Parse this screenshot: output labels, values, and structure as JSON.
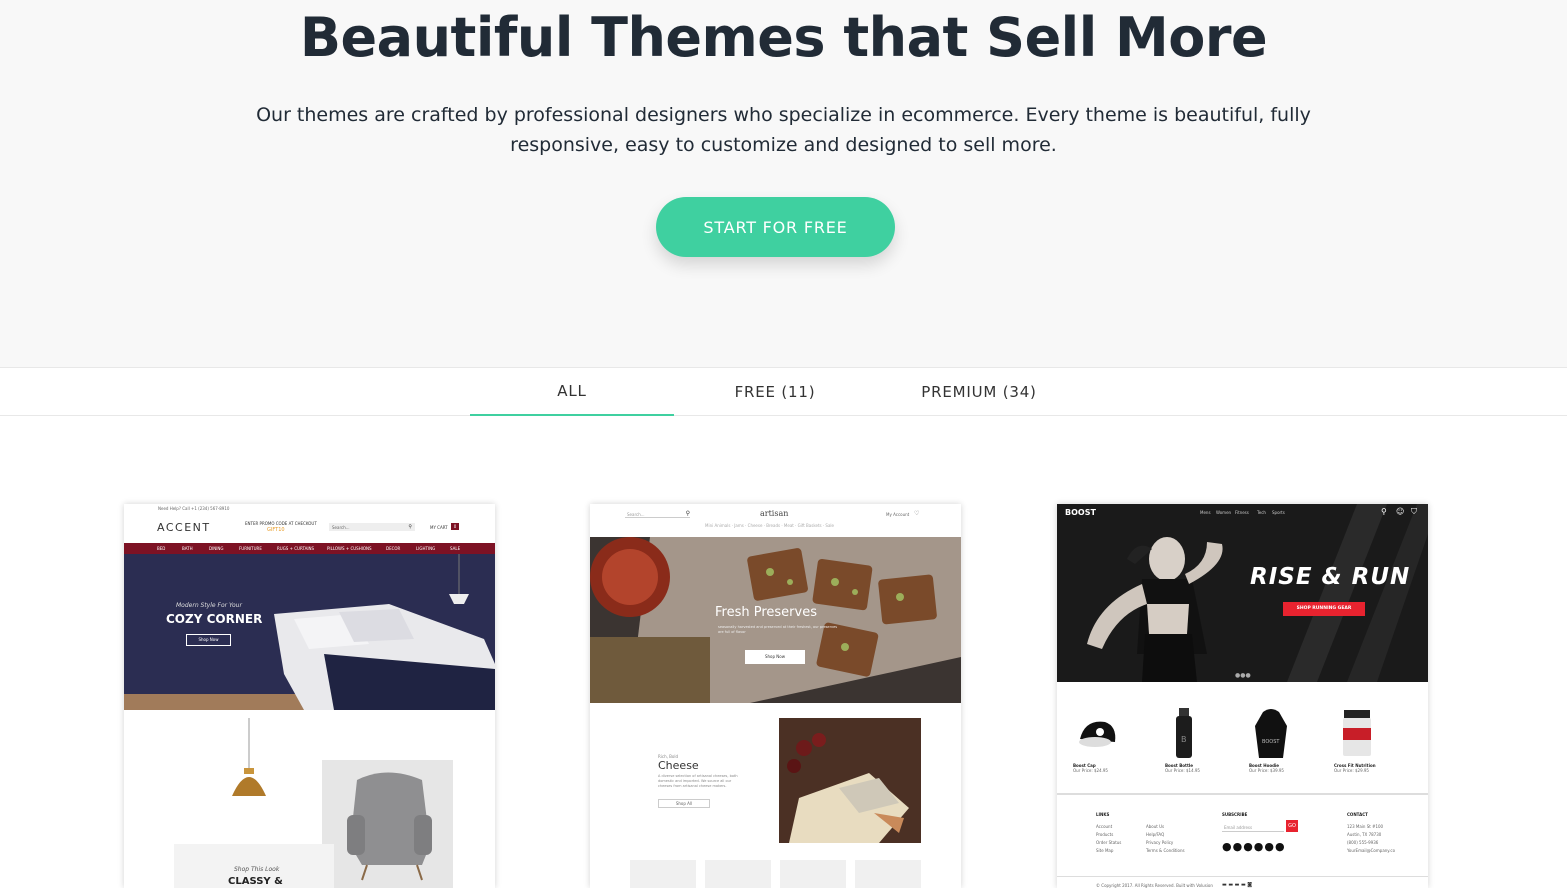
{
  "hero": {
    "title": "Beautiful Themes that Sell More",
    "subtitle": "Our themes are crafted by professional designers who specialize in ecommerce. Every theme is beautiful, fully responsive, easy to customize and designed to sell more.",
    "cta_label": "START FOR FREE"
  },
  "tabs": [
    {
      "label": "ALL",
      "active": true
    },
    {
      "label": "FREE (11)",
      "active": false
    },
    {
      "label": "PREMIUM (34)",
      "active": false
    }
  ],
  "accent_theme": {
    "logo": "ACCENT",
    "promo": "ENTER PROMO CODE AT CHECKOUT",
    "promo_code": "GIFT10",
    "search_placeholder": "Search...",
    "cart_label": "MY CART",
    "cart_count": "0",
    "nav": [
      "BED",
      "BATH",
      "DINING",
      "FURNITURE",
      "RUGS + CURTAINS",
      "PILLOWS + CUSHIONS",
      "DECOR",
      "LIGHTING",
      "SALE"
    ],
    "hero_kicker": "Modern Style For Your",
    "hero_title": "COZY CORNER",
    "hero_button": "Shop Now",
    "shop_look_kicker": "Shop This Look",
    "shop_look_title": "CLASSY &"
  },
  "artisan_theme": {
    "logo": "artisan",
    "search_placeholder": "Search...",
    "account_label": "My Account",
    "hero_title": "Fresh Preserves",
    "hero_text": "seasonally harvested and preserved at their freshest, our preserves are full of flavor",
    "hero_button": "Shop Now",
    "feature_kicker": "Rich, Bold",
    "feature_title": "Cheese",
    "feature_text": "A diverse selection of artisanal cheeses, both domestic and imported. We source all our cheeses from artisanal cheese makers.",
    "feature_button": "Shop All"
  },
  "boost_theme": {
    "logo": "BOOST",
    "nav": [
      "Mens",
      "Women",
      "Fitness",
      "Tech",
      "Sports"
    ],
    "hero_title": "RISE & RUN",
    "hero_button": "SHOP RUNNING GEAR",
    "products": [
      {
        "name": "Boost Cap",
        "price": "Our Price: $24.95"
      },
      {
        "name": "Boost Bottle",
        "price": "Our Price: $14.95"
      },
      {
        "name": "Boost Hoodie",
        "price": "Our Price: $39.95"
      },
      {
        "name": "Cross Fit Nutrition",
        "price": "Our Price: $29.95"
      }
    ],
    "footer_links_heading": "LINKS",
    "footer_subscribe_heading": "SUBSCRIBE",
    "footer_contact_heading": "CONTACT",
    "footer_email_placeholder": "Email address",
    "footer_go": "GO",
    "accent_red": "#e8232f"
  },
  "colors": {
    "accent": "#3fd0a0",
    "heading": "#212b36",
    "accent_theme_nav": "#7d1224"
  }
}
